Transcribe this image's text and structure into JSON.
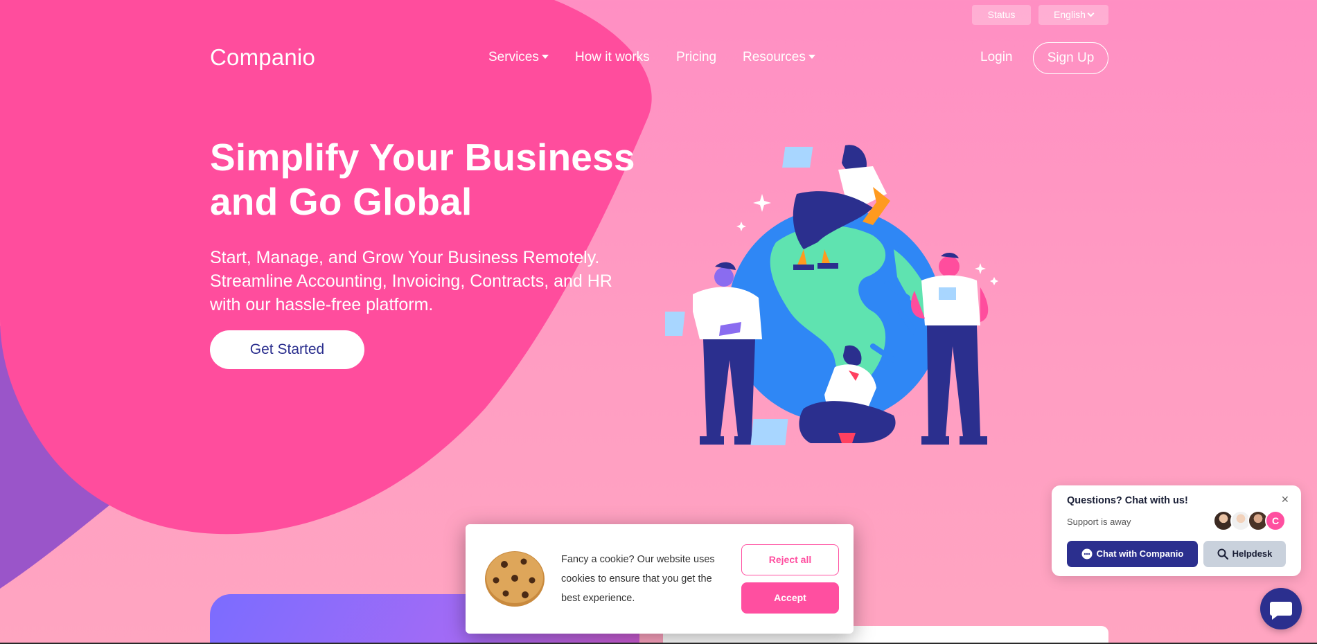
{
  "topbar": {
    "status_label": "Status",
    "language_label": "English"
  },
  "nav": {
    "logo": "Companio",
    "items": [
      {
        "label": "Services",
        "has_dropdown": true
      },
      {
        "label": "How it works",
        "has_dropdown": false
      },
      {
        "label": "Pricing",
        "has_dropdown": false
      },
      {
        "label": "Resources",
        "has_dropdown": true
      }
    ],
    "login_label": "Login",
    "signup_label": "Sign Up"
  },
  "hero": {
    "title_line1": "Simplify Your Business",
    "title_line2": "and Go Global",
    "subtitle_line1": "Start, Manage, and Grow Your Business Remotely.",
    "subtitle_line2": "Streamline Accounting, Invoicing, Contracts, and HR",
    "subtitle_line3": "with our hassle-free platform.",
    "cta_label": "Get Started"
  },
  "cookie_banner": {
    "text_line1": "Fancy a cookie? Our website uses",
    "text_line2": "cookies to ensure that you get the",
    "text_line3": "best experience.",
    "reject_label": "Reject all",
    "accept_label": "Accept"
  },
  "chat_widget": {
    "title": "Questions? Chat with us!",
    "status": "Support is away",
    "close_icon": "close-icon",
    "avatar_letter": "C",
    "chat_button_label": "Chat with Companio",
    "helpdesk_label": "Helpdesk"
  },
  "colors": {
    "accent_pink": "#ff4fa0",
    "navy": "#2b2f8e",
    "blob_pink": "#ff4d9d",
    "purple": "#9a55c9"
  }
}
